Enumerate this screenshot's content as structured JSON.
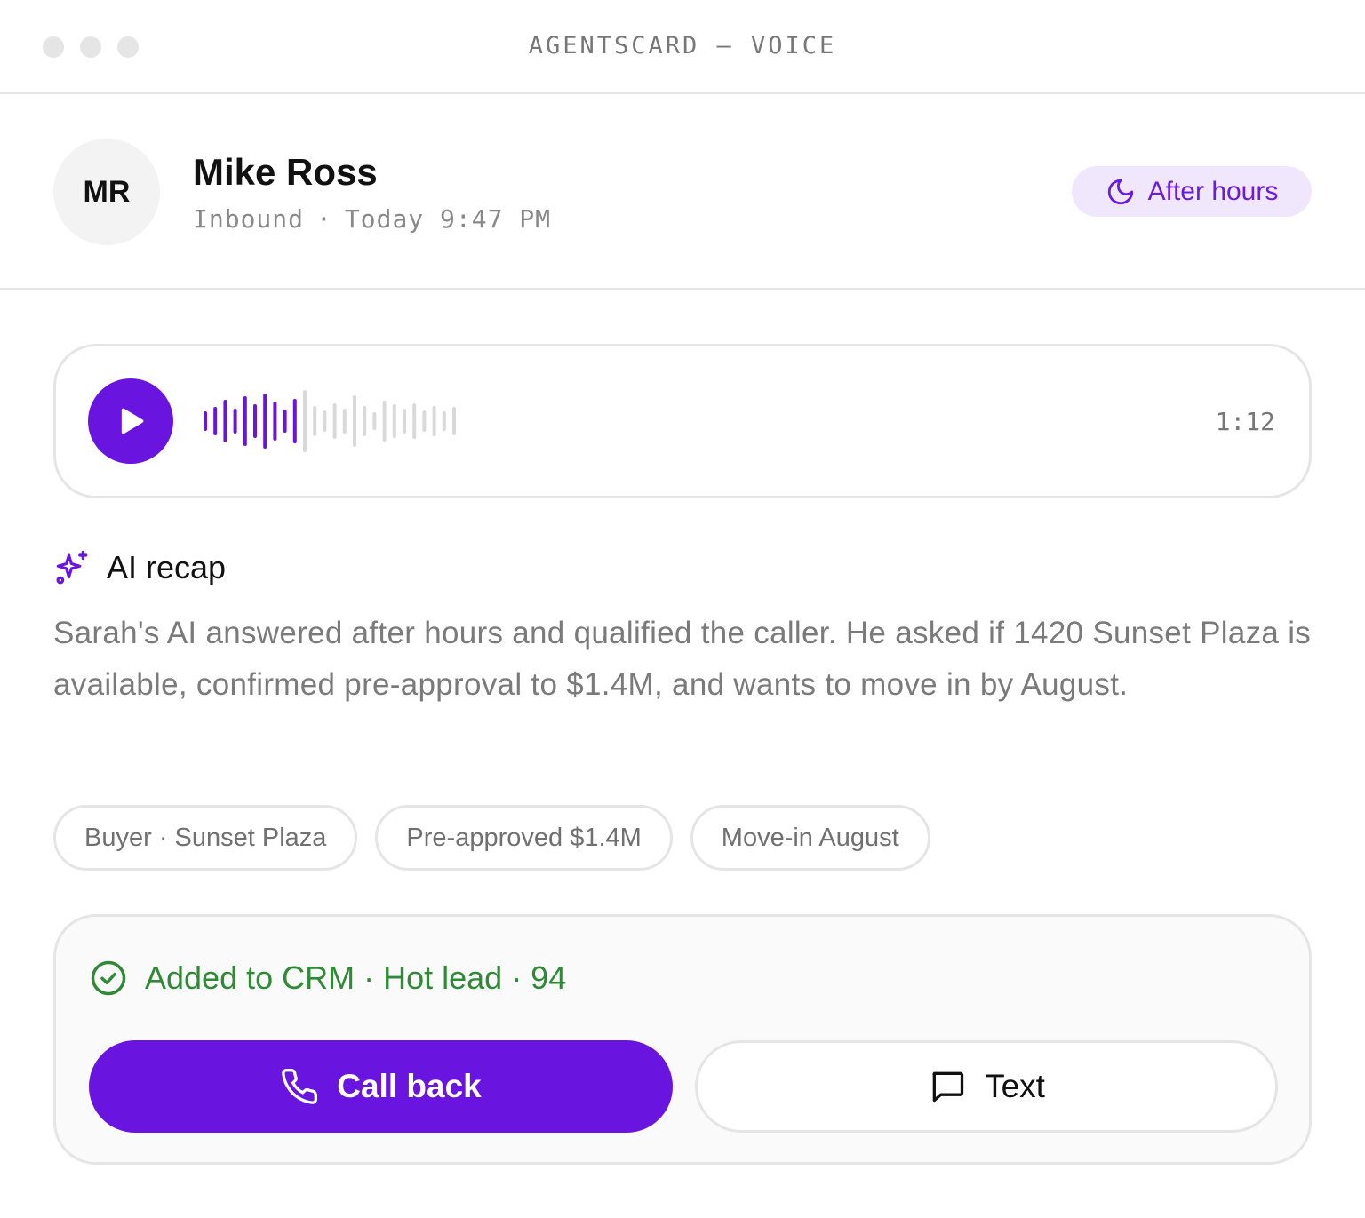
{
  "window": {
    "title": "AGENTSCARD — VOICE"
  },
  "caller": {
    "initials": "MR",
    "name": "Mike Ross",
    "direction": "Inbound",
    "separator": "·",
    "time": "Today 9:47 PM",
    "badge_label": "After hours",
    "badge_icon": "moon-icon"
  },
  "audio": {
    "duration": "1:12",
    "progress": 0.4,
    "played_color": "#6a14e0",
    "unplayed_color": "#d9d9d9"
  },
  "recap": {
    "title": "AI recap",
    "text": "Sarah's AI answered after hours and qualified the caller. He asked if 1420 Sunset Plaza is available, confirmed pre-approval to $1.4M, and wants to move in by August."
  },
  "tags": [
    "Buyer · Sunset Plaza",
    "Pre-approved $1.4M",
    "Move-in August"
  ],
  "crm": {
    "status": "Added to CRM · Hot lead · 94",
    "status_color": "#2f8a35",
    "call_label": "Call back",
    "text_label": "Text"
  },
  "colors": {
    "accent": "#6a14e0",
    "badge_bg": "#f0e7fd"
  }
}
